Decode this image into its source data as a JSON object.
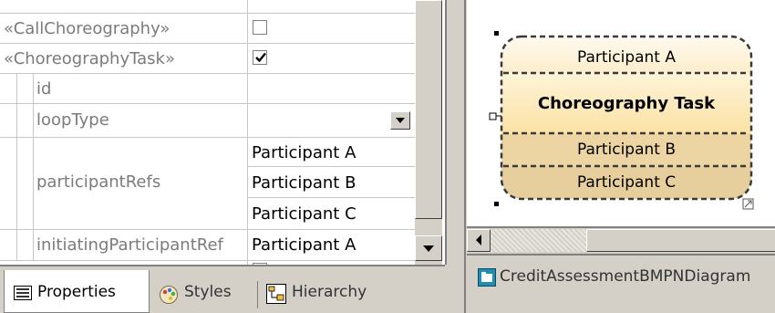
{
  "properties": {
    "rows": [
      {
        "label": "«CallChoreography»",
        "type": "checkbox",
        "checked": false
      },
      {
        "label": "«ChoreographyTask»",
        "type": "checkbox",
        "checked": true
      },
      {
        "label": "id",
        "type": "text",
        "value": ""
      },
      {
        "label": "loopType",
        "type": "combo",
        "value": ""
      },
      {
        "label": "participantRefs",
        "type": "list",
        "values": [
          "Participant A",
          "Participant B",
          "Participant C"
        ]
      },
      {
        "label": "initiatingParticipantRef",
        "type": "text",
        "value": "Participant A"
      }
    ]
  },
  "tabs": [
    {
      "label": "Properties",
      "icon": "properties-icon",
      "active": true
    },
    {
      "label": "Styles",
      "icon": "styles-icon",
      "active": false
    },
    {
      "label": "Hierarchy",
      "icon": "hierarchy-icon",
      "active": false
    }
  ],
  "diagram": {
    "task": {
      "top_participant": "Participant A",
      "name": "Choreography Task",
      "bottom_participants": [
        "Participant B",
        "Participant C"
      ]
    }
  },
  "document_tab": {
    "label": "CreditAssessmentBMPNDiagram",
    "icon": "diagram-icon"
  },
  "colors": {
    "top_band": "#fef6df",
    "middle_band": "#fde9b8",
    "bottom_band": "#e9d3a2",
    "chrome": "#d4d0c8"
  }
}
